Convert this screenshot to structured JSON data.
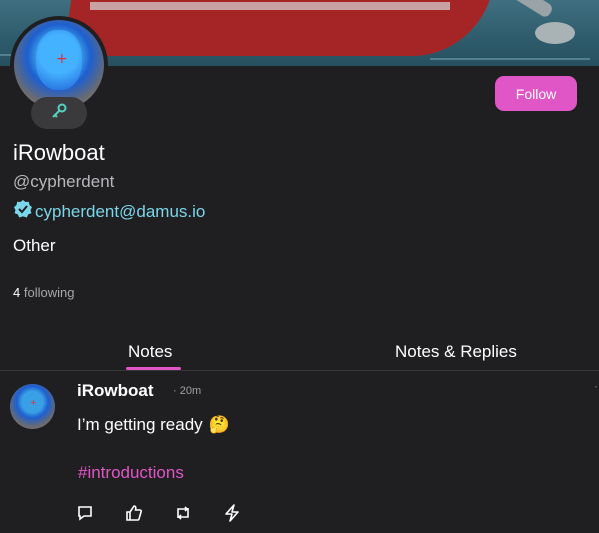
{
  "profile": {
    "display_name": "iRowboat",
    "handle": "@cypherdent",
    "nip05": "cypherdent@damus.io",
    "about": "Other",
    "following_count": "4",
    "following_label": "following",
    "follow_button": "Follow"
  },
  "tabs": [
    {
      "label": "Notes",
      "active": true
    },
    {
      "label": "Notes & Replies",
      "active": false
    }
  ],
  "post": {
    "author": "iRowboat",
    "time": "· 20m",
    "text": "I’m getting ready",
    "emoji": "🤔",
    "hashtag": "#introductions",
    "actions": [
      "reply-icon",
      "like-icon",
      "repost-icon",
      "zap-icon"
    ]
  },
  "colors": {
    "accent": "#e056c6",
    "verified": "#7ad6e8",
    "background": "#1f1f21"
  },
  "icons": [
    "key-icon",
    "verified-check-icon"
  ]
}
